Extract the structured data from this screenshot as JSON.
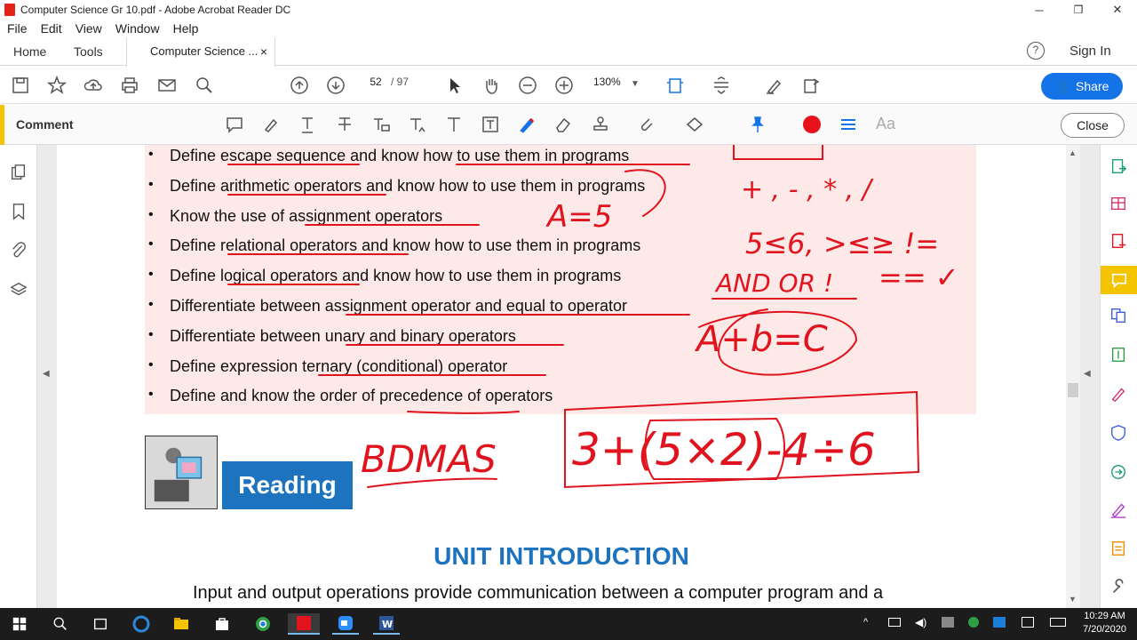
{
  "window": {
    "title": "Computer Science Gr 10.pdf - Adobe Acrobat Reader DC",
    "minimize": "─",
    "maximize": "❐",
    "close": "✕"
  },
  "menu": [
    "File",
    "Edit",
    "View",
    "Window",
    "Help"
  ],
  "tabs": {
    "home": "Home",
    "tools": "Tools",
    "document": "Computer Science ...",
    "close": "×",
    "help": "?",
    "sign_in": "Sign In"
  },
  "toolbar": {
    "page_current": "52",
    "page_total": "/ 97",
    "zoom": "130%",
    "share": "Share"
  },
  "comment_bar": {
    "label": "Comment",
    "font_label": "Aa",
    "close": "Close",
    "accent": "#f5c400",
    "color_swatch": "#e8121b"
  },
  "document": {
    "objectives": [
      "Define escape sequence and know how to use them in programs",
      "Define arithmetic operators and know how to use them in programs",
      "Know the use of assignment operators",
      "Define relational operators and know how to use them in programs",
      "Define logical operators and know how to use them in programs",
      "Differentiate between assignment operator and equal to operator",
      "Differentiate between unary and binary operators",
      "Define expression ternary (conditional) operator",
      "Define and know the order of precedence of operators"
    ],
    "reading_label": "Reading",
    "unit_title": "UNIT INTRODUCTION",
    "intro_text": "Input and output operations provide communication between a computer program and a"
  },
  "annotations": {
    "ink_color": "#e0141e",
    "assign_example": "A=5",
    "arith_ops": "+ , - , * , /",
    "relational": "5≤6, >≤≥ !=",
    "logical": "AND OR !",
    "equal": "== ✓",
    "expression": "A+b=C",
    "bdmas": "BDMAS",
    "precedence_example": "3+(5×2)-4÷6"
  },
  "taskbar": {
    "time": "10:29 AM",
    "date": "7/20/2020"
  }
}
